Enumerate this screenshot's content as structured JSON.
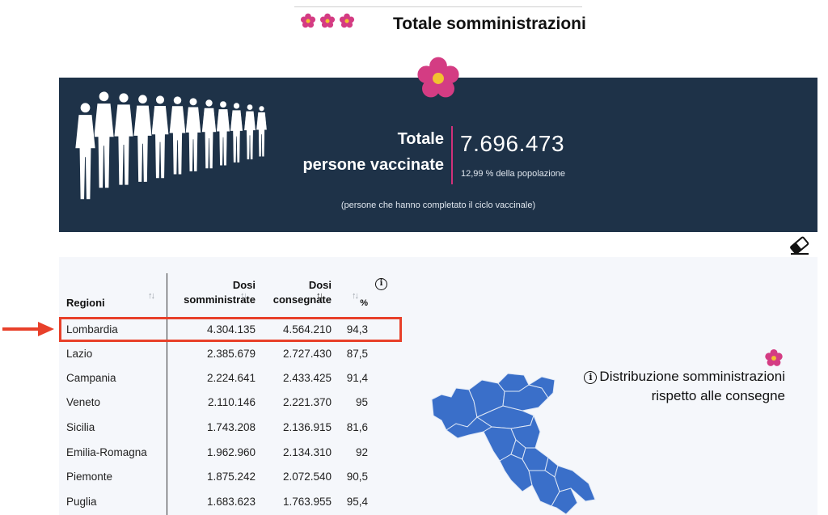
{
  "header": {
    "title": "Totale somministrazioni"
  },
  "summary": {
    "label_line1": "Totale",
    "label_line2": "persone vaccinate",
    "value": "7.696.473",
    "percent_text": "12,99 % della popolazione",
    "note": "(persone che hanno completato il ciclo vaccinale)"
  },
  "table": {
    "headers": {
      "regioni": "Regioni",
      "somministrate_1": "Dosi",
      "somministrate_2": "somministrate",
      "consegnate_1": "Dosi",
      "consegnate_2": "consegnate",
      "percent": "%"
    },
    "rows": [
      {
        "regione": "Lombardia",
        "somministrate": "4.304.135",
        "consegnate": "4.564.210",
        "percent": "94,3"
      },
      {
        "regione": "Lazio",
        "somministrate": "2.385.679",
        "consegnate": "2.727.430",
        "percent": "87,5"
      },
      {
        "regione": "Campania",
        "somministrate": "2.224.641",
        "consegnate": "2.433.425",
        "percent": "91,4"
      },
      {
        "regione": "Veneto",
        "somministrate": "2.110.146",
        "consegnate": "2.221.370",
        "percent": "95"
      },
      {
        "regione": "Sicilia",
        "somministrate": "1.743.208",
        "consegnate": "2.136.915",
        "percent": "81,6"
      },
      {
        "regione": "Emilia-Romagna",
        "somministrate": "1.962.960",
        "consegnate": "2.134.310",
        "percent": "92"
      },
      {
        "regione": "Piemonte",
        "somministrate": "1.875.242",
        "consegnate": "2.072.540",
        "percent": "90,5"
      },
      {
        "regione": "Puglia",
        "somministrate": "1.683.623",
        "consegnate": "1.763.955",
        "percent": "95,4"
      }
    ]
  },
  "map": {
    "title_line1": "Distribuzione somministrazioni",
    "title_line2": "rispetto alle consegne",
    "info_glyph": "i"
  },
  "icons": {
    "flower": "primula-flower-icon",
    "crowd": "crowd-silhouette-icon",
    "eraser": "eraser-icon",
    "info": "info-icon",
    "arrow": "red-arrow-icon",
    "sort": "sort-icon"
  },
  "colors": {
    "banner_bg": "#1e3248",
    "accent_pink": "#d0317a",
    "highlight_red": "#e8402a",
    "map_blue": "#3a6fc9"
  }
}
